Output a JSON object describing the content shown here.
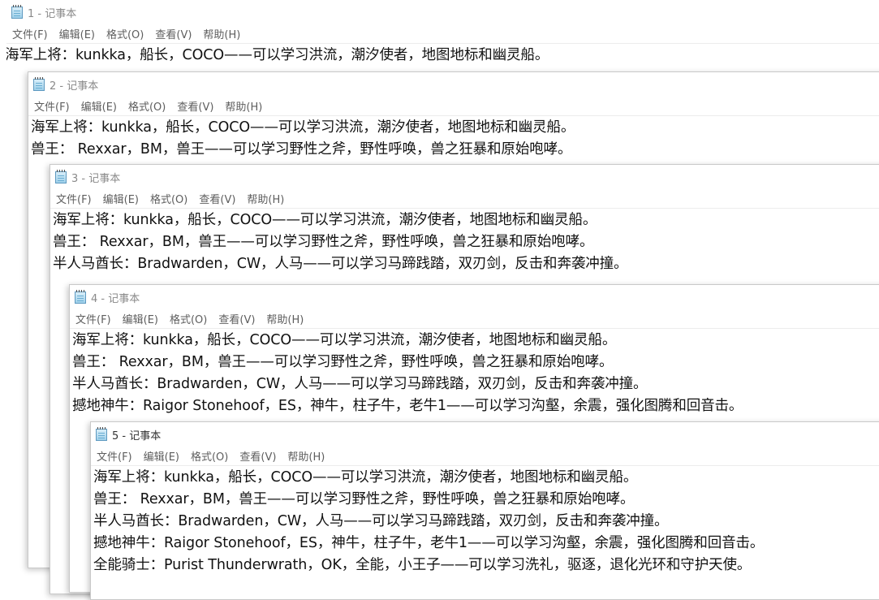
{
  "menu": [
    "文件(F)",
    "编辑(E)",
    "格式(O)",
    "查看(V)",
    "帮助(H)"
  ],
  "lines": [
    "海军上将：kunkka，船长，COCO——可以学习洪流，潮汐使者，地图地标和幽灵船。",
    "兽王： Rexxar，BM，兽王——可以学习野性之斧，野性呼唤，兽之狂暴和原始咆哮。",
    "半人马酋长：Bradwarden，CW，人马——可以学习马蹄践踏，双刃剑，反击和奔袭冲撞。",
    "撼地神牛：Raigor Stonehoof，ES，神牛，柱子牛，老牛1——可以学习沟壑，余震，强化图腾和回音击。",
    "全能骑士：Purist Thunderwrath，OK，全能，小王子——可以学习洗礼，驱逐，退化光环和守护天使。"
  ],
  "windows": [
    {
      "title": "1 - 记事本",
      "lines": [
        "海军上将：kunkka，船长，COCO——可以学习洪流，潮汐使者，地图地标和幽灵船。"
      ]
    },
    {
      "title": "2 - 记事本",
      "lines": [
        "海军上将：kunkka，船长，COCO——可以学习洪流，潮汐使者，地图地标和幽灵船。",
        "兽王： Rexxar，BM，兽王——可以学习野性之斧，野性呼唤，兽之狂暴和原始咆哮。"
      ]
    },
    {
      "title": "3 - 记事本",
      "lines": [
        "海军上将：kunkka，船长，COCO——可以学习洪流，潮汐使者，地图地标和幽灵船。",
        "兽王： Rexxar，BM，兽王——可以学习野性之斧，野性呼唤，兽之狂暴和原始咆哮。",
        "半人马酋长：Bradwarden，CW，人马——可以学习马蹄践踏，双刃剑，反击和奔袭冲撞。"
      ]
    },
    {
      "title": "4 - 记事本",
      "lines": [
        "海军上将：kunkka，船长，COCO——可以学习洪流，潮汐使者，地图地标和幽灵船。",
        "兽王： Rexxar，BM，兽王——可以学习野性之斧，野性呼唤，兽之狂暴和原始咆哮。",
        "半人马酋长：Bradwarden，CW，人马——可以学习马蹄践踏，双刃剑，反击和奔袭冲撞。",
        "撼地神牛：Raigor Stonehoof，ES，神牛，柱子牛，老牛1——可以学习沟壑，余震，强化图腾和回音击。"
      ]
    },
    {
      "title": "5 - 记事本",
      "lines": [
        "海军上将：kunkka，船长，COCO——可以学习洪流，潮汐使者，地图地标和幽灵船。",
        "兽王： Rexxar，BM，兽王——可以学习野性之斧，野性呼唤，兽之狂暴和原始咆哮。",
        "半人马酋长：Bradwarden，CW，人马——可以学习马蹄践踏，双刃剑，反击和奔袭冲撞。",
        "撼地神牛：Raigor Stonehoof，ES，神牛，柱子牛，老牛1——可以学习沟壑，余震，强化图腾和回音击。",
        "全能骑士：Purist Thunderwrath，OK，全能，小王子——可以学习洗礼，驱逐，退化光环和守护天使。"
      ]
    }
  ]
}
